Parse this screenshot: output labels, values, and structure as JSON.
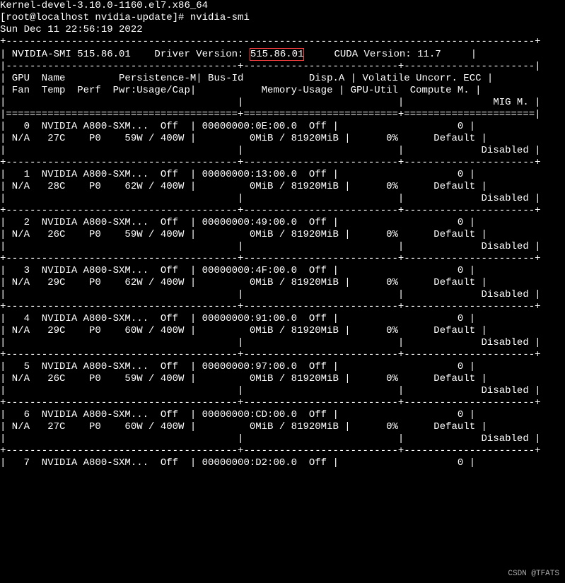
{
  "prompt_line": "[root@localhost nvidia-update]# nvidia-smi",
  "timestamp_line": "Sun Dec 11 22:56:19 2022",
  "kernel_partial": "Kernel-devel-3.10.0-1160.el7.x86_64",
  "header": {
    "smi_label": "NVIDIA-SMI",
    "smi_version": "515.86.01",
    "driver_label": "Driver Version:",
    "driver_version": "515.86.01",
    "cuda_label": "CUDA Version:",
    "cuda_version": "11.7"
  },
  "col_headers": {
    "gpu": "GPU",
    "name": "Name",
    "persistence": "Persistence-M",
    "busid": "Bus-Id",
    "dispA": "Disp.A",
    "volatile": "Volatile Uncorr. ECC",
    "fan": "Fan",
    "temp": "Temp",
    "perf": "Perf",
    "pwr": "Pwr:Usage/Cap",
    "mem": "Memory-Usage",
    "gpuutil": "GPU-Util",
    "compute": "Compute M.",
    "mig": "MIG M."
  },
  "gpus": [
    {
      "idx": "0",
      "name": "NVIDIA A800-SXM...",
      "persist": "Off",
      "bus": "00000000:0E:00.0",
      "disp": "Off",
      "ecc": "0",
      "fan": "N/A",
      "temp": "27C",
      "perf": "P0",
      "pwr": "59W / 400W",
      "mem": "0MiB / 81920MiB",
      "util": "0%",
      "compute": "Default",
      "mig": "Disabled"
    },
    {
      "idx": "1",
      "name": "NVIDIA A800-SXM...",
      "persist": "Off",
      "bus": "00000000:13:00.0",
      "disp": "Off",
      "ecc": "0",
      "fan": "N/A",
      "temp": "28C",
      "perf": "P0",
      "pwr": "62W / 400W",
      "mem": "0MiB / 81920MiB",
      "util": "0%",
      "compute": "Default",
      "mig": "Disabled"
    },
    {
      "idx": "2",
      "name": "NVIDIA A800-SXM...",
      "persist": "Off",
      "bus": "00000000:49:00.0",
      "disp": "Off",
      "ecc": "0",
      "fan": "N/A",
      "temp": "26C",
      "perf": "P0",
      "pwr": "59W / 400W",
      "mem": "0MiB / 81920MiB",
      "util": "0%",
      "compute": "Default",
      "mig": "Disabled"
    },
    {
      "idx": "3",
      "name": "NVIDIA A800-SXM...",
      "persist": "Off",
      "bus": "00000000:4F:00.0",
      "disp": "Off",
      "ecc": "0",
      "fan": "N/A",
      "temp": "29C",
      "perf": "P0",
      "pwr": "62W / 400W",
      "mem": "0MiB / 81920MiB",
      "util": "0%",
      "compute": "Default",
      "mig": "Disabled"
    },
    {
      "idx": "4",
      "name": "NVIDIA A800-SXM...",
      "persist": "Off",
      "bus": "00000000:91:00.0",
      "disp": "Off",
      "ecc": "0",
      "fan": "N/A",
      "temp": "29C",
      "perf": "P0",
      "pwr": "60W / 400W",
      "mem": "0MiB / 81920MiB",
      "util": "0%",
      "compute": "Default",
      "mig": "Disabled"
    },
    {
      "idx": "5",
      "name": "NVIDIA A800-SXM...",
      "persist": "Off",
      "bus": "00000000:97:00.0",
      "disp": "Off",
      "ecc": "0",
      "fan": "N/A",
      "temp": "26C",
      "perf": "P0",
      "pwr": "59W / 400W",
      "mem": "0MiB / 81920MiB",
      "util": "0%",
      "compute": "Default",
      "mig": "Disabled"
    },
    {
      "idx": "6",
      "name": "NVIDIA A800-SXM...",
      "persist": "Off",
      "bus": "00000000:CD:00.0",
      "disp": "Off",
      "ecc": "0",
      "fan": "N/A",
      "temp": "27C",
      "perf": "P0",
      "pwr": "60W / 400W",
      "mem": "0MiB / 81920MiB",
      "util": "0%",
      "compute": "Default",
      "mig": "Disabled"
    },
    {
      "idx": "7",
      "name": "NVIDIA A800-SXM...",
      "persist": "Off",
      "bus": "00000000:D2:00.0",
      "disp": "Off",
      "ecc": "0"
    }
  ],
  "watermark": "CSDN @TFATS"
}
